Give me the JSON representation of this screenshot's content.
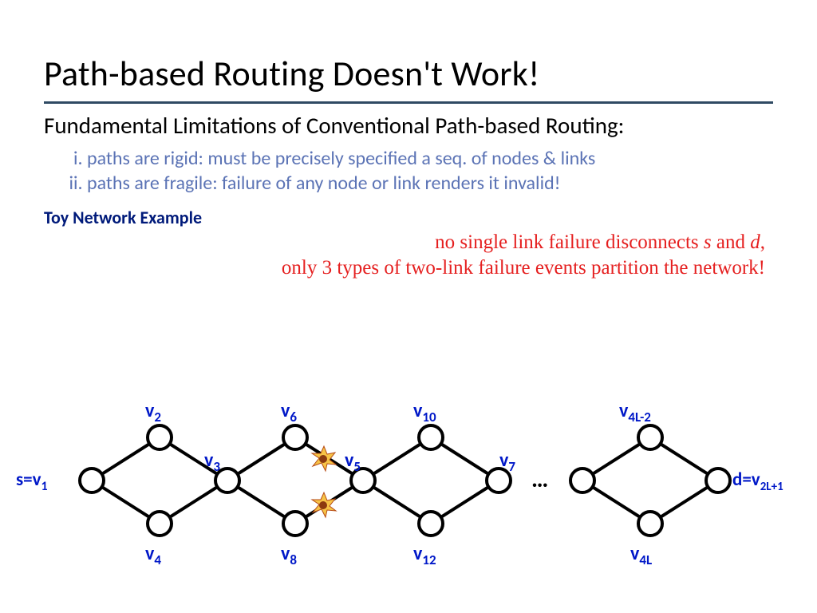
{
  "title": "Path-based Routing Doesn't Work!",
  "subtitle": "Fundamental Limitations of Conventional Path-based Routing:",
  "bullets": [
    "paths are rigid: must be precisely specified a seq. of nodes & links",
    "paths are fragile: failure of any node or link renders it invalid!"
  ],
  "example_label": "Toy Network Example",
  "red_line1_a": "no single link failure disconnects ",
  "red_line1_s": "s",
  "red_line1_b": " and ",
  "red_line1_d": "d",
  "red_line1_c": ",",
  "red_line2": "only 3 types of two-link failure events partition the network!",
  "ellipsis": "…",
  "labels": {
    "s": "s=v",
    "s_sub": "1",
    "v2": "v",
    "v2_sub": "2",
    "v3": "v",
    "v3_sub": "3",
    "v4": "v",
    "v4_sub": "4",
    "v5": "v",
    "v5_sub": "5",
    "v6": "v",
    "v6_sub": "6",
    "v7": "v",
    "v7_sub": "7",
    "v8": "v",
    "v8_sub": "8",
    "v10": "v",
    "v10_sub": "10",
    "v12": "v",
    "v12_sub": "12",
    "v4l2": "v",
    "v4l2_sub": "4L-2",
    "v4l": "v",
    "v4l_sub": "4L",
    "d": "d=v",
    "d_sub": "2L+1"
  }
}
